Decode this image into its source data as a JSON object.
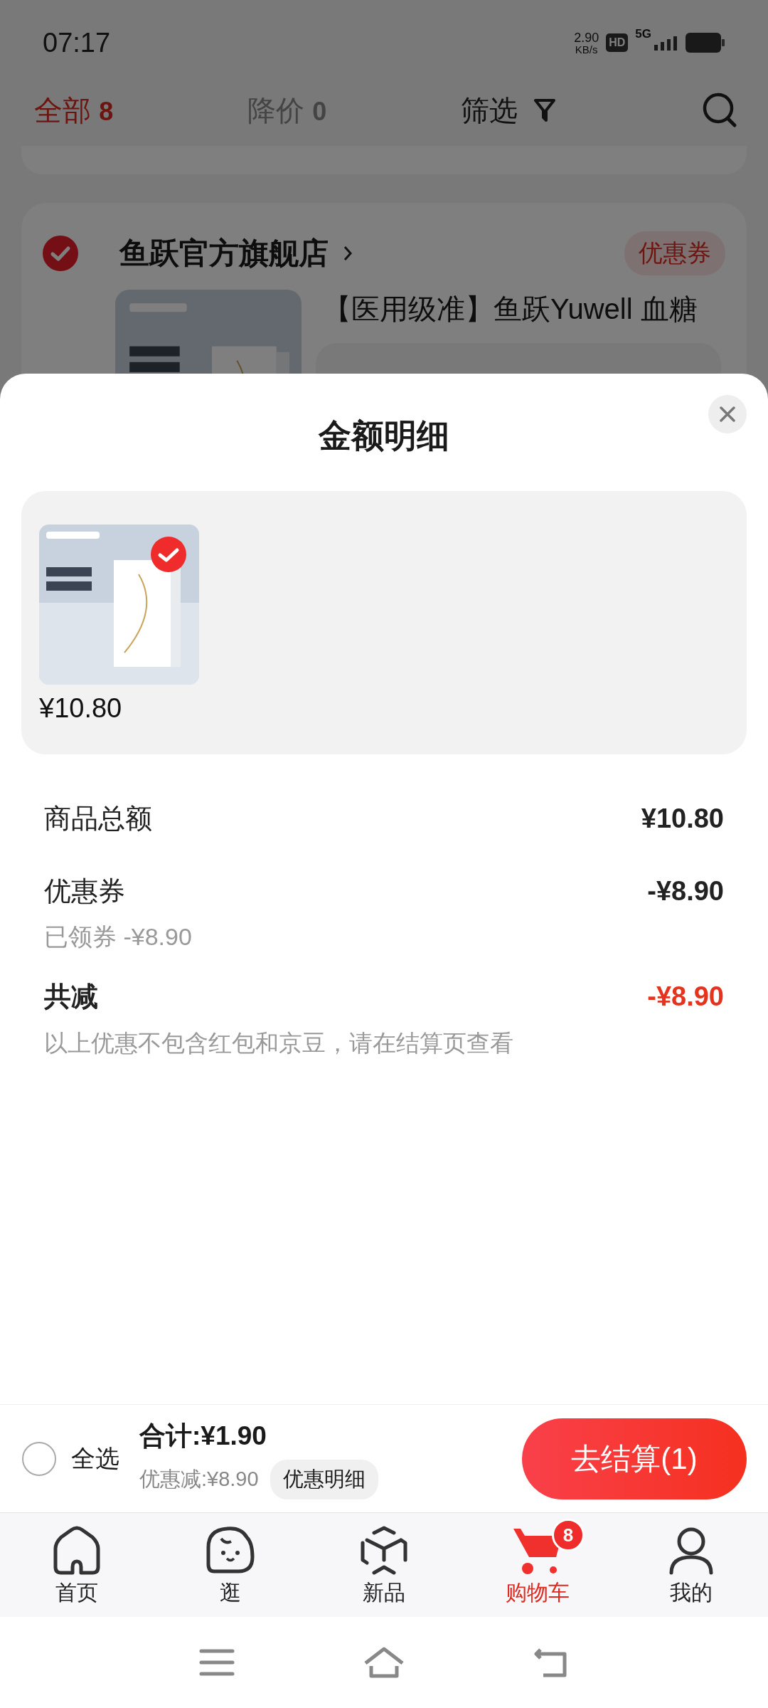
{
  "status_bar": {
    "time": "07:17",
    "net_speed": "2.90",
    "net_unit": "KB/s",
    "hd": "HD",
    "network": "5G"
  },
  "filter_tabs": [
    {
      "label": "全部",
      "count": "8",
      "selected": true
    },
    {
      "label": "降价",
      "count": "0",
      "selected": false
    }
  ],
  "filter": {
    "label": "筛选"
  },
  "store": {
    "name": "鱼跃官方旗舰店",
    "checked": true,
    "coupon": "优惠券"
  },
  "product": {
    "title": "【医用级准】鱼跃Yuwell 血糖"
  },
  "sheet": {
    "title": "金额明细",
    "items": [
      {
        "price": "¥10.80",
        "selected": true
      }
    ],
    "rows": [
      {
        "kind": "line",
        "label": "商品总额",
        "value": "¥10.80"
      },
      {
        "kind": "line",
        "label": "优惠券",
        "value": "-¥8.90"
      },
      {
        "kind": "sub",
        "label": "已领券 -¥8.90"
      },
      {
        "kind": "total",
        "label": "共减",
        "value": "-¥8.90"
      },
      {
        "kind": "note",
        "label": "以上优惠不包含红包和京豆，请在结算页查看"
      }
    ]
  },
  "checkout": {
    "select_all": {
      "label": "全选",
      "checked": false
    },
    "total": "合计:¥1.90",
    "discount": "优惠减:¥8.90",
    "detail_button": "优惠明细",
    "submit": "去结算(1)"
  },
  "tab_bar": [
    {
      "label": "首页",
      "selected": false
    },
    {
      "label": "逛",
      "selected": false
    },
    {
      "label": "新品",
      "selected": false
    },
    {
      "label": "购物车",
      "badge": "8",
      "selected": true
    },
    {
      "label": "我的",
      "selected": false
    }
  ]
}
